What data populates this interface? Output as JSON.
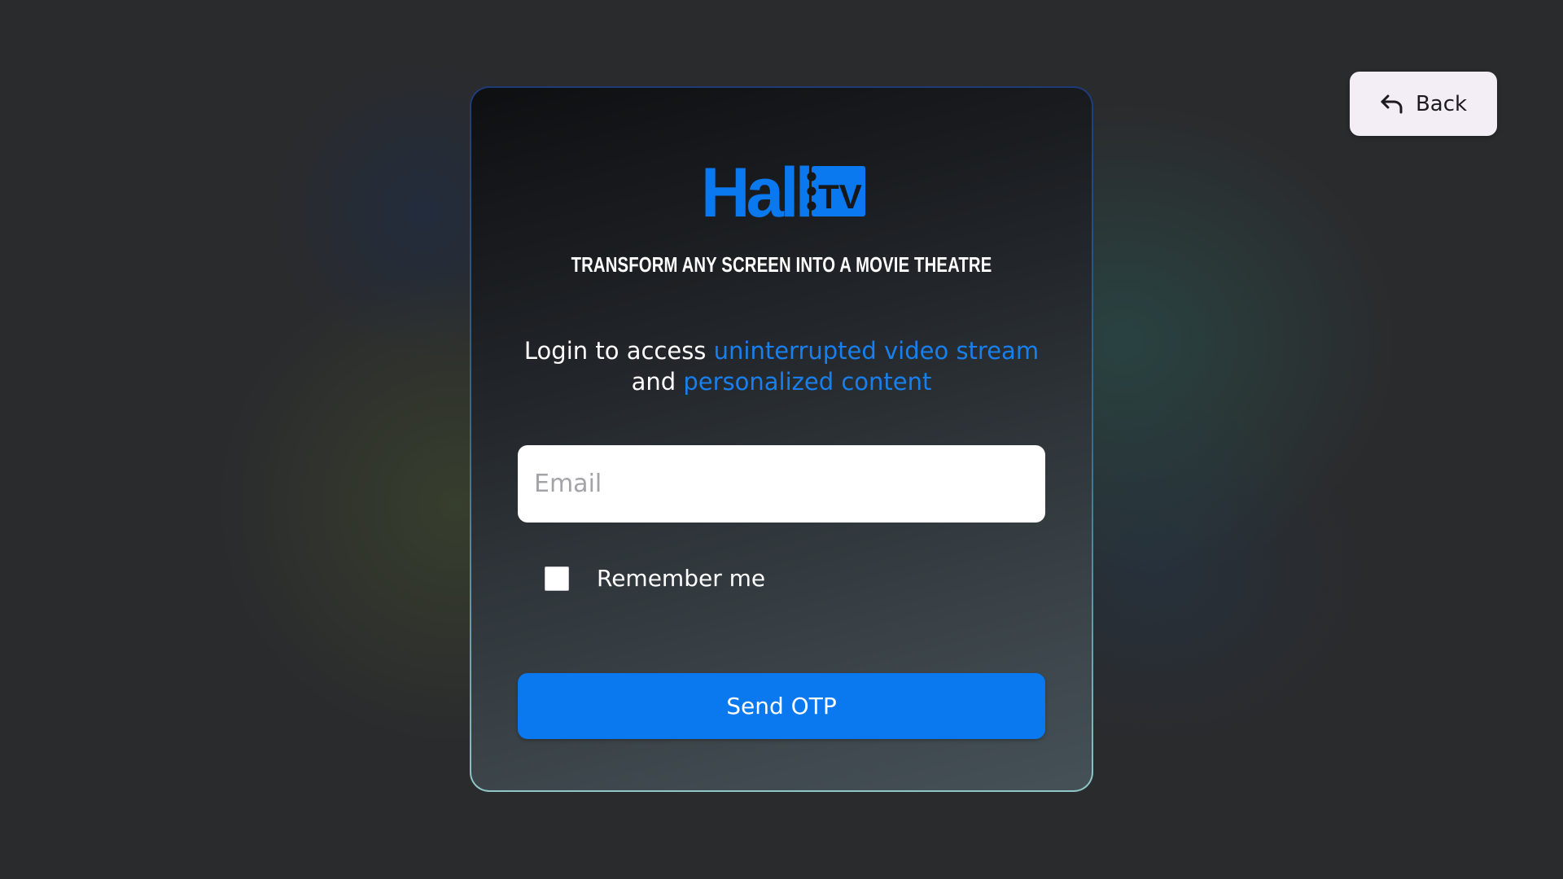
{
  "back_button": {
    "label": "Back",
    "icon": "undo-arrow-icon"
  },
  "logo": {
    "text": "Hall",
    "badge_text": "TV",
    "icon": "ticket-icon",
    "color": "#0a78ee"
  },
  "tagline": "TRANSFORM ANY SCREEN INTO A MOVIE THEATRE",
  "intro": {
    "prefix": "Login to access ",
    "highlight1": "uninterrupted video stream",
    "middle": "and ",
    "highlight2": "personalized content"
  },
  "email": {
    "placeholder": "Email",
    "value": ""
  },
  "remember": {
    "label": "Remember me",
    "checked": false
  },
  "send_button": {
    "label": "Send OTP"
  },
  "colors": {
    "accent": "#0a78ee",
    "highlight_text": "#1880ee",
    "background": "#2a2b2d"
  }
}
